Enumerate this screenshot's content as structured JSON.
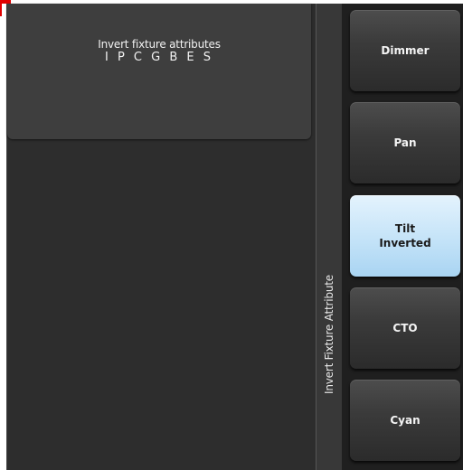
{
  "prompt": {
    "title": "Invert fixture attributes",
    "attribute_keys": "I P C G B E S"
  },
  "side_strip": {
    "label": "Invert Fixture Attribute"
  },
  "softkeys": [
    {
      "label": "Dimmer",
      "active": false
    },
    {
      "label": "Pan",
      "active": false
    },
    {
      "label": "Tilt\nInverted",
      "active": true
    },
    {
      "label": "CTO",
      "active": false
    },
    {
      "label": "Cyan",
      "active": false
    }
  ],
  "colors": {
    "panel_bg": "#2d2d2d",
    "prompt_bg": "#3e3e3e",
    "active_key": "#c4e3f8",
    "corner_marker": "#e00000"
  }
}
